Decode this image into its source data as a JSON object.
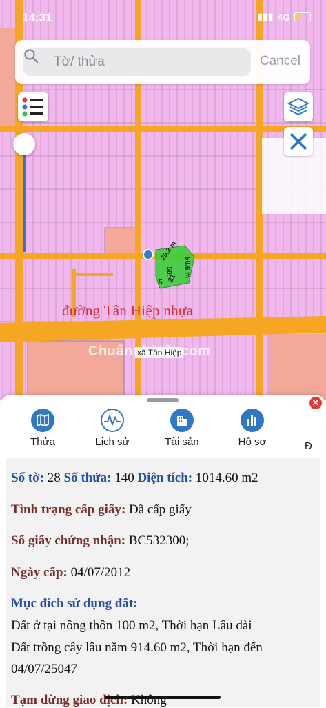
{
  "status": {
    "time": "14:31",
    "network": "4G"
  },
  "search": {
    "placeholder": "Tờ/ thửa",
    "cancel_label": "Cancel"
  },
  "map": {
    "road_label": "đường Tân Hiệp nhựa",
    "admin_label": "xã Tân Hiệp",
    "watermark": "Chuẩnnhàtốt.com",
    "dimensions": [
      "20.2 m",
      "50.6 m",
      "50.",
      "5",
      "21"
    ]
  },
  "tabs": [
    {
      "label": "Thửa",
      "icon": "map-icon"
    },
    {
      "label": "Lịch sử",
      "icon": "history-chart-icon"
    },
    {
      "label": "Tài sản",
      "icon": "building-icon"
    },
    {
      "label": "Hồ sơ",
      "icon": "document-icon"
    },
    {
      "label": "Đ",
      "icon": ""
    }
  ],
  "details": {
    "so_to_label": "Số tờ:",
    "so_to": "28",
    "so_thua_label": "Số thửa:",
    "so_thua": "140",
    "dien_tich_label": "Diện tích:",
    "dien_tich": "1014.60 m2",
    "tinh_trang_label": "Tình trạng cấp giấy:",
    "tinh_trang": "Đã cấp giấy",
    "so_giay_label": "Số giấy chứng nhận:",
    "so_giay": "BC532300;",
    "ngay_cap_label": "Ngày cấp:",
    "ngay_cap": "04/07/2012",
    "muc_dich_label": "Mục đích sử dụng đất:",
    "muc_dich_line1": "Đất ở tại nông thôn 100 m2, Thời hạn Lâu dài",
    "muc_dich_line2": "Đất trồng cây lâu năm 914.60 m2, Thời hạn đến",
    "muc_dich_line3": "04/07/25047",
    "tam_dung_label": "Tạm dừng giao dịch:",
    "tam_dung": "Không"
  },
  "colors": {
    "parcel": "#f2b8ee",
    "road": "#f5a623",
    "selected": "#3ccf3c",
    "accent": "#2f78c8"
  }
}
